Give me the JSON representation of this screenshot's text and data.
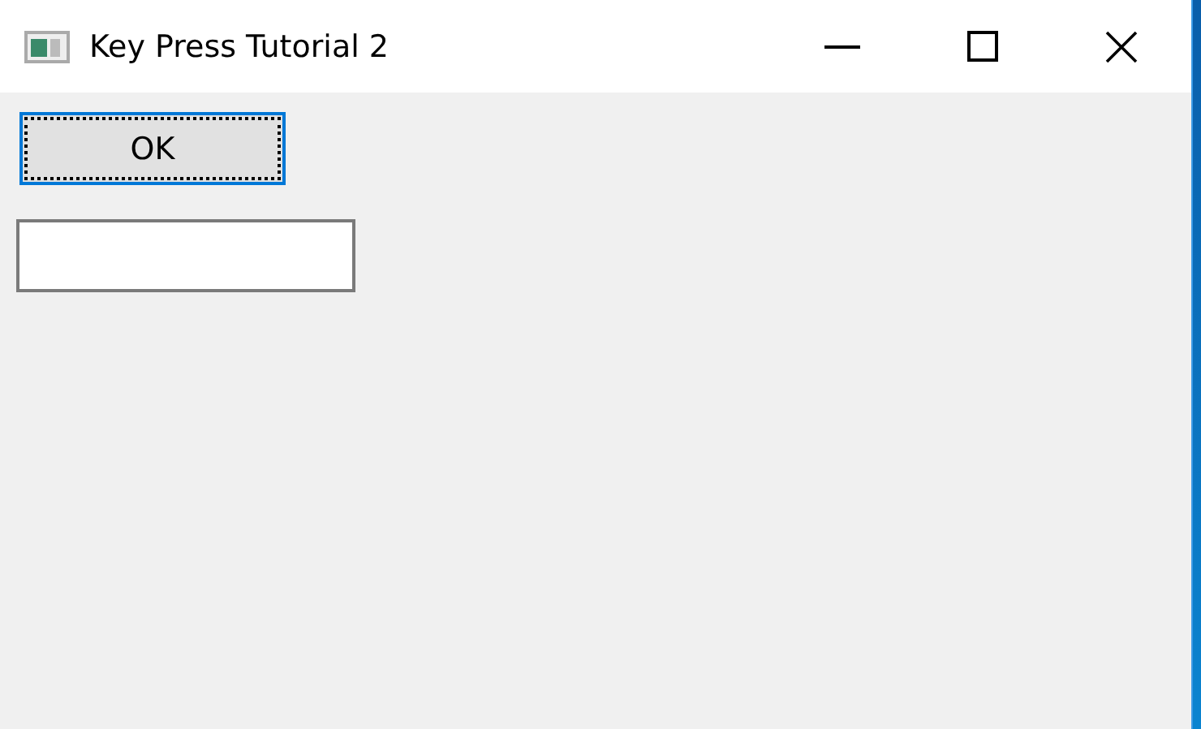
{
  "window": {
    "title": "Key Press Tutorial 2"
  },
  "ok_button": {
    "label": "OK",
    "focused": true
  },
  "text_field": {
    "focused": false
  }
}
